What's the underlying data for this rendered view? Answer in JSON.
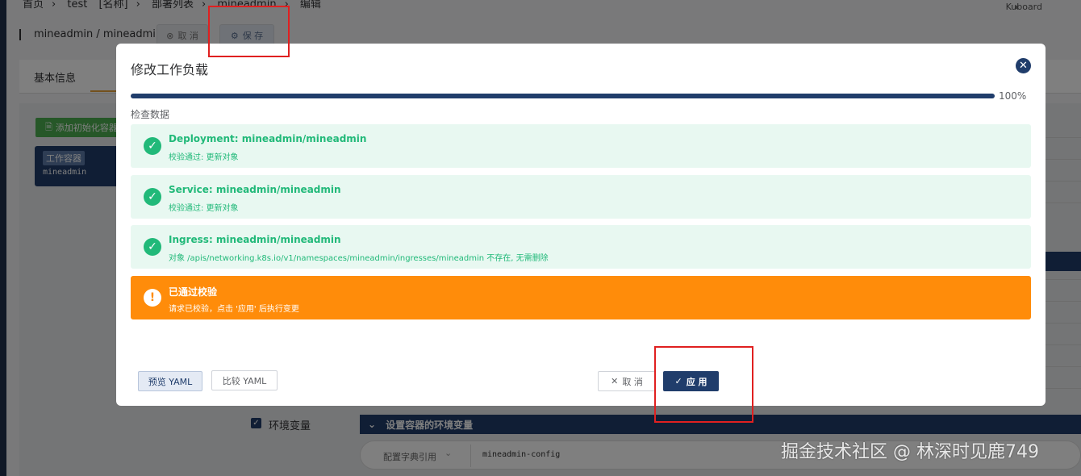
{
  "background": {
    "breadcrumb": [
      "首页",
      "test",
      "[名称]",
      "部署列表",
      "mineadmin",
      "编辑"
    ],
    "brand": "Kuboard",
    "page_path": "mineadmin / mineadmin",
    "cancel_label": "取 消",
    "save_label": "保 存",
    "tab_basic": "基本信息",
    "add_init_container": "添加初始化容器",
    "container_tag": "工作容器",
    "container_name": "mineadmin",
    "env_label": "环境变量",
    "env_header": "设置容器的环境变量",
    "env_source": "配置字典引用",
    "env_value": "mineadmin-config"
  },
  "dialog": {
    "title": "修改工作负载",
    "progress": 100,
    "progress_text": "100%",
    "section_label": "检查数据",
    "alerts": [
      {
        "type": "success",
        "title": "Deployment: mineadmin/mineadmin",
        "desc": "校验通过: 更新对象"
      },
      {
        "type": "success",
        "title": "Service: mineadmin/mineadmin",
        "desc": "校验通过: 更新对象"
      },
      {
        "type": "success",
        "title": "Ingress: mineadmin/mineadmin",
        "desc": "对象 /apis/networking.k8s.io/v1/namespaces/mineadmin/ingresses/mineadmin 不存在, 无需删除"
      },
      {
        "type": "warning",
        "title": "已通过校验",
        "desc": "请求已校验，点击 '应用' 后执行变更"
      }
    ],
    "preview_yaml": "预览 YAML",
    "compare_yaml": "比较 YAML",
    "cancel": "取 消",
    "apply": "应 用"
  },
  "watermark": "掘金技术社区 @ 林深时见鹿749",
  "colors": {
    "primary": "#203d6b",
    "success": "#21b979",
    "warning": "#ff8c0a",
    "highlight": "#e02020"
  }
}
